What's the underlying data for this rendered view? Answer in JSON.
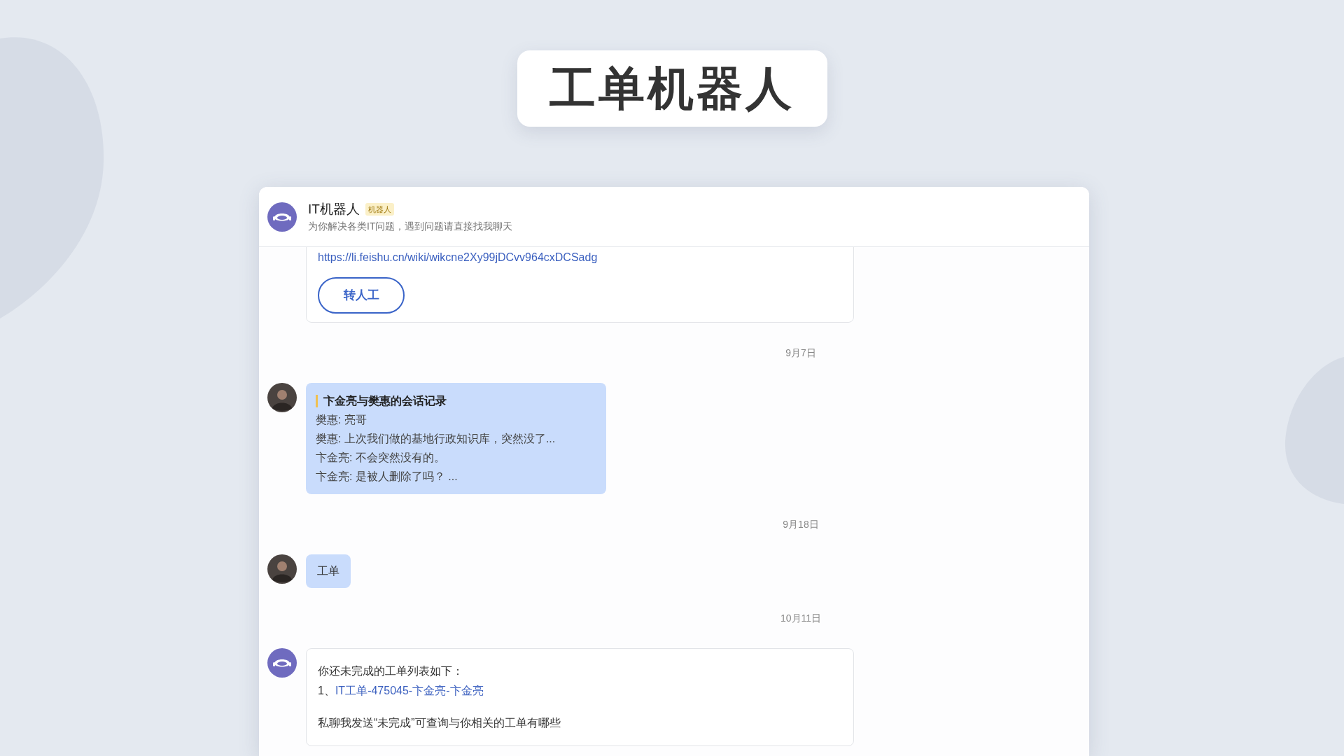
{
  "title": "工单机器人",
  "chat": {
    "name": "IT机器人",
    "badge": "机器人",
    "description": "为你解决各类IT问题，遇到问题请直接找我聊天"
  },
  "messages": [
    {
      "kind": "bot_card",
      "link": "https://li.feishu.cn/wiki/wikcne2Xy99jDCvv964cxDCSadg",
      "button": "转人工"
    },
    {
      "kind": "date",
      "text": "9月7日"
    },
    {
      "kind": "record",
      "title": "卞金亮与樊惠的会话记录",
      "lines": [
        "樊惠: 亮哥",
        "樊惠: 上次我们做的基地行政知识库，突然没了...",
        "卞金亮: 不会突然没有的。",
        "卞金亮: 是被人删除了吗？ ..."
      ]
    },
    {
      "kind": "date",
      "text": "9月18日"
    },
    {
      "kind": "text",
      "text": "工单"
    },
    {
      "kind": "date",
      "text": "10月11日"
    },
    {
      "kind": "bot_list",
      "intro": "你还未完成的工单列表如下：",
      "items": [
        {
          "number": "1、",
          "link": "IT工单-475045-卞金亮-卞金亮"
        }
      ],
      "note": "私聊我发送“未完成”可查询与你相关的工单有哪些"
    }
  ]
}
